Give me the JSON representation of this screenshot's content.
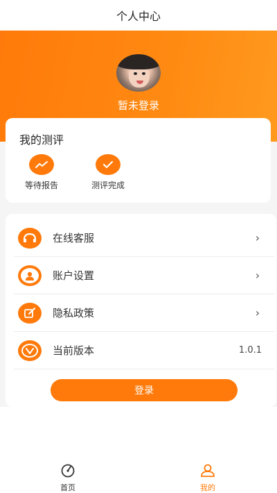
{
  "header": {
    "title": "个人中心"
  },
  "profile": {
    "status_text": "暂未登录"
  },
  "evaluation": {
    "title": "我的测评",
    "items": [
      {
        "label": "等待报告",
        "icon": "trend-icon"
      },
      {
        "label": "测评完成",
        "icon": "check-icon"
      }
    ]
  },
  "menu": {
    "items": [
      {
        "label": "在线客服",
        "icon": "customer-service-icon"
      },
      {
        "label": "账户设置",
        "icon": "user-icon"
      },
      {
        "label": "隐私政策",
        "icon": "edit-icon"
      },
      {
        "label": "当前版本",
        "icon": "version-icon",
        "value": "1.0.1"
      }
    ]
  },
  "login_button": {
    "label": "登录"
  },
  "tabs": [
    {
      "label": "首页",
      "icon": "home-icon",
      "active": false
    },
    {
      "label": "我的",
      "icon": "person-icon",
      "active": true
    }
  ],
  "colors": {
    "accent": "#ff7a0a",
    "inactive": "#333333"
  }
}
